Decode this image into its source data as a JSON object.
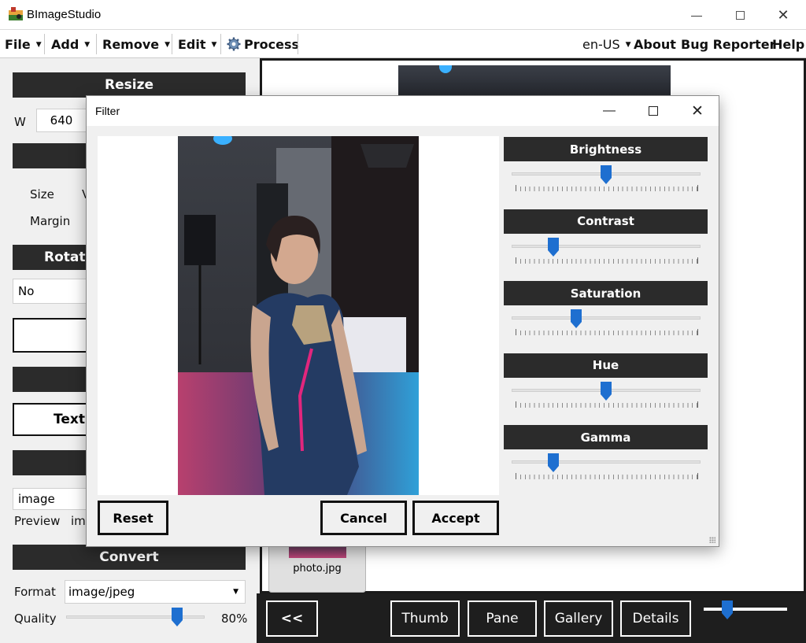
{
  "window": {
    "title": "BImageStudio",
    "minimize_icon": "minimize-icon",
    "maximize_icon": "maximize-icon",
    "close_icon": "close-icon"
  },
  "menu": {
    "left": [
      {
        "label": "File",
        "caret": "▼"
      },
      {
        "label": "Add",
        "caret": "▼"
      },
      {
        "label": "Remove",
        "caret": "▼"
      },
      {
        "label": "Edit",
        "caret": "▼"
      },
      {
        "label": "Process",
        "icon": "gear-icon"
      }
    ],
    "locale": {
      "label": "en-US",
      "caret": "▼"
    },
    "right": [
      "About",
      "Bug Reporter",
      "Help"
    ]
  },
  "left_panel": {
    "resize": {
      "title": "Resize",
      "w_label": "W",
      "w_value": "640"
    },
    "size_label": "Size",
    "size_partial": "V",
    "margin_label": "Margin",
    "rotate": {
      "title": "Rotate",
      "value": "No"
    },
    "text_button": "Text",
    "watermark_value": "image",
    "preview_label": "Preview",
    "preview_value": "ima",
    "convert": {
      "title": "Convert",
      "format_label": "Format",
      "format_value": "image/jpeg",
      "quality_label": "Quality",
      "quality_value": "80%",
      "quality_fraction": 0.8
    }
  },
  "gallery": {
    "file_name": "photo.jpg"
  },
  "bottom_bar": {
    "back_label": "<<",
    "buttons": [
      "Thumb",
      "Pane",
      "Gallery",
      "Details"
    ],
    "zoom_fraction": 0.28
  },
  "dialog": {
    "title": "Filter",
    "sliders": [
      {
        "label": "Brightness",
        "value": 0.5
      },
      {
        "label": "Contrast",
        "value": 0.22
      },
      {
        "label": "Saturation",
        "value": 0.34
      },
      {
        "label": "Hue",
        "value": 0.5
      },
      {
        "label": "Gamma",
        "value": 0.22
      }
    ],
    "reset_label": "Reset",
    "cancel_label": "Cancel",
    "accept_label": "Accept"
  },
  "colors": {
    "accent": "#1e6fd0",
    "header": "#2b2b2b",
    "bar": "#1e1e1e"
  }
}
